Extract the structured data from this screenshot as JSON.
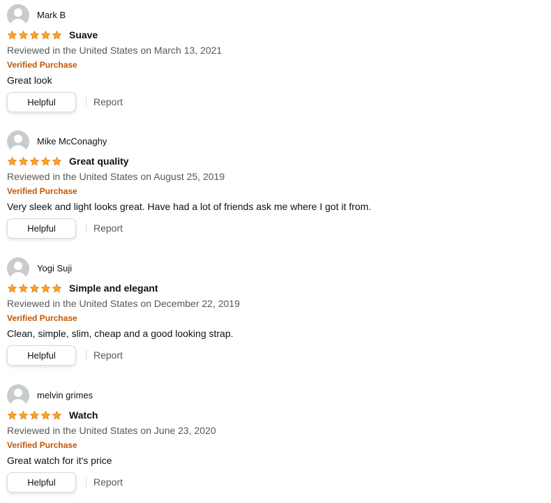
{
  "reviews": [
    {
      "reviewer": "Mark B",
      "avatar_icon": "user-avatar-icon",
      "rating": 5,
      "title": "Suave",
      "date": "Reviewed in the United States on March 13, 2021",
      "verified": "Verified Purchase",
      "body": "Great look",
      "helpful_label": "Helpful",
      "report_label": "Report"
    },
    {
      "reviewer": "Mike McConaghy",
      "avatar_icon": "user-avatar-icon",
      "rating": 5,
      "title": "Great quality",
      "date": "Reviewed in the United States on August 25, 2019",
      "verified": "Verified Purchase",
      "body": "Very sleek and light looks great. Have had a lot of friends ask me where I got it from.",
      "helpful_label": "Helpful",
      "report_label": "Report"
    },
    {
      "reviewer": "Yogi Suji",
      "avatar_icon": "user-avatar-icon",
      "rating": 5,
      "title": "Simple and elegant",
      "date": "Reviewed in the United States on December 22, 2019",
      "verified": "Verified Purchase",
      "body": "Clean, simple, slim, cheap and a good looking strap.",
      "helpful_label": "Helpful",
      "report_label": "Report"
    },
    {
      "reviewer": "melvin grimes",
      "avatar_icon": "user-avatar-icon",
      "rating": 5,
      "title": "Watch",
      "date": "Reviewed in the United States on June 23, 2020",
      "verified": "Verified Purchase",
      "body": "Great watch for it's price",
      "helpful_label": "Helpful",
      "report_label": "Report"
    }
  ],
  "colors": {
    "star_fill": "#ffa41c",
    "star_stroke": "#de7921",
    "verified": "#c45500",
    "secondary_text": "#565959"
  }
}
